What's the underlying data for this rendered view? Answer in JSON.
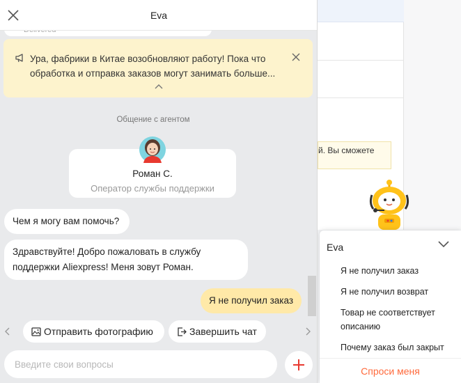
{
  "background": {
    "snippet_text": "й. Вы сможете"
  },
  "chat": {
    "title": "Eva",
    "previous_message_status": "Delivered",
    "notice": {
      "text": "Ура, фабрики в Китае возобновляют работу! Пока что обработка и отправка заказов могут занимать больше..."
    },
    "system_label": "Общение с агентом",
    "agent": {
      "name": "Роман С.",
      "role": "Оператор службы поддержки"
    },
    "messages": [
      {
        "from": "agent",
        "text": "Чем я могу вам помочь?"
      },
      {
        "from": "agent",
        "text": "Здравствуйте! Добро пожаловать в службу поддержки Aliexpress! Меня зовут Роман."
      },
      {
        "from": "user",
        "text": "Я не получил заказ"
      }
    ],
    "quick_actions": {
      "send_photo": "Отправить фотографию",
      "end_chat": "Завершить чат"
    },
    "input": {
      "placeholder": "Введите свои вопросы",
      "value": ""
    }
  },
  "quick_panel": {
    "title": "Eva",
    "items": [
      "Я не получил заказ",
      "Я не получил возврат",
      "Товар не соответствует описанию",
      "Почему заказ был закрыт"
    ],
    "footer": "Спроси меня"
  },
  "colors": {
    "notice_bg": "#fdf3cd",
    "user_bubble": "#ffe9a8",
    "accent": "#ff6a3c",
    "send_plus": "#e8392f"
  }
}
